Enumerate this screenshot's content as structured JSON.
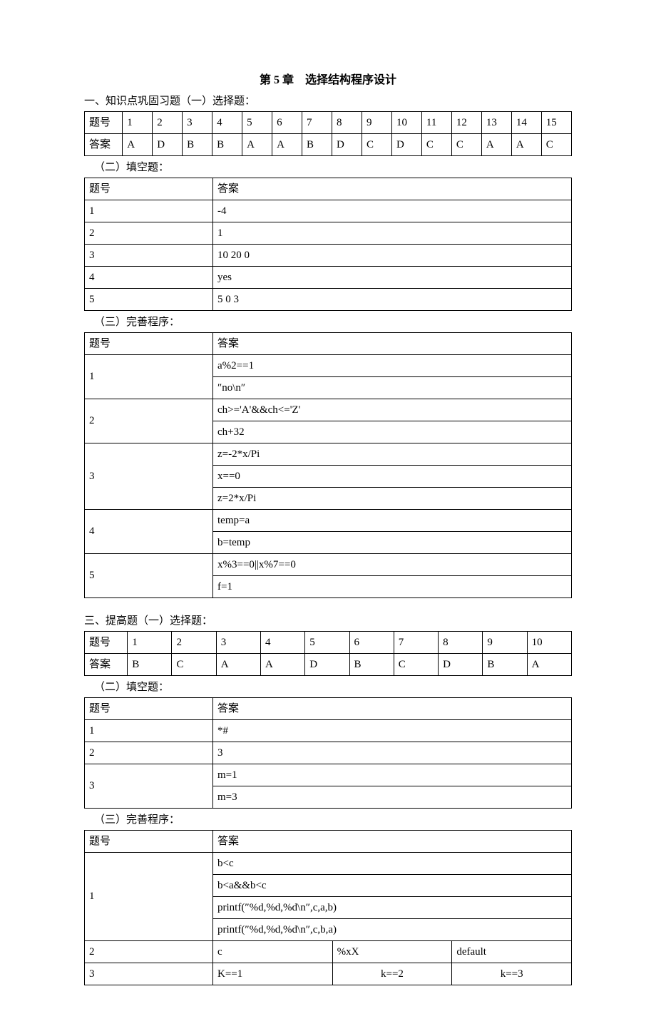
{
  "title": "第 5 章　选择结构程序设计",
  "s1_heading": "一、知识点巩固习题（一）选择题：",
  "s1_row1_h": "题号",
  "s1_row1": [
    "1",
    "2",
    "3",
    "4",
    "5",
    "6",
    "7",
    "8",
    "9",
    "10",
    "11",
    "12",
    "13",
    "14",
    "15"
  ],
  "s1_row2_h": "答案",
  "s1_row2": [
    "A",
    "D",
    "B",
    "B",
    "A",
    "A",
    "B",
    "D",
    "C",
    "D",
    "C",
    "C",
    "A",
    "A",
    "C"
  ],
  "s2_heading": "（二）填空题：",
  "s2_th1": "题号",
  "s2_th2": "答案",
  "s2_rows": [
    [
      "1",
      "-4"
    ],
    [
      "2",
      "1"
    ],
    [
      "3",
      "10 20 0"
    ],
    [
      "4",
      "yes"
    ],
    [
      "5",
      "5 0 3"
    ]
  ],
  "s3_heading": "（三）完善程序：",
  "s3_th1": "题号",
  "s3_th2": "答案",
  "s3_q1": "1",
  "s3_q1_a1": "a%2==1",
  "s3_q1_a2": "″no\\n″",
  "s3_q2": "2",
  "s3_q2_a1": "ch>='A'&&ch<='Z'",
  "s3_q2_a2": "ch+32",
  "s3_q3": "3",
  "s3_q3_a1": "z=-2*x/Pi",
  "s3_q3_a2": "x==0",
  "s3_q3_a3": "z=2*x/Pi",
  "s3_q4": "4",
  "s3_q4_a1": "temp=a",
  "s3_q4_a2": "b=temp",
  "s3_q5": "5",
  "s3_q5_a1": "x%3==0||x%7==0",
  "s3_q5_a2": "f=1",
  "s4_heading": "三、提高题（一）选择题：",
  "s4_row1_h": "题号",
  "s4_row1": [
    "1",
    "2",
    "3",
    "4",
    "5",
    "6",
    "7",
    "8",
    "9",
    "10"
  ],
  "s4_row2_h": "答案",
  "s4_row2": [
    "B",
    "C",
    "A",
    "A",
    "D",
    "B",
    "C",
    "D",
    "B",
    "A"
  ],
  "s5_heading": "（二）填空题：",
  "s5_th1": "题号",
  "s5_th2": "答案",
  "s5_r1_n": "1",
  "s5_r1_a": "*#",
  "s5_r2_n": "2",
  "s5_r2_a": "3",
  "s5_r3_n": "3",
  "s5_r3_a1": "m=1",
  "s5_r3_a2": "m=3",
  "s6_heading": "（三）完善程序：",
  "s6_th1": "题号",
  "s6_th2": "答案",
  "s6_q1": "1",
  "s6_q1_a1": "b<c",
  "s6_q1_a2": "b<a&&b<c",
  "s6_q1_a3": "printf(″%d,%d,%d\\n″,c,a,b)",
  "s6_q1_a4": "printf(″%d,%d,%d\\n″,c,b,a)",
  "s6_q2": "2",
  "s6_q2_a1": "c",
  "s6_q2_a2": "%xX",
  "s6_q2_a3": "default",
  "s6_q3": "3",
  "s6_q3_a1": "K==1",
  "s6_q3_a2": "k==2",
  "s6_q3_a3": "k==3"
}
